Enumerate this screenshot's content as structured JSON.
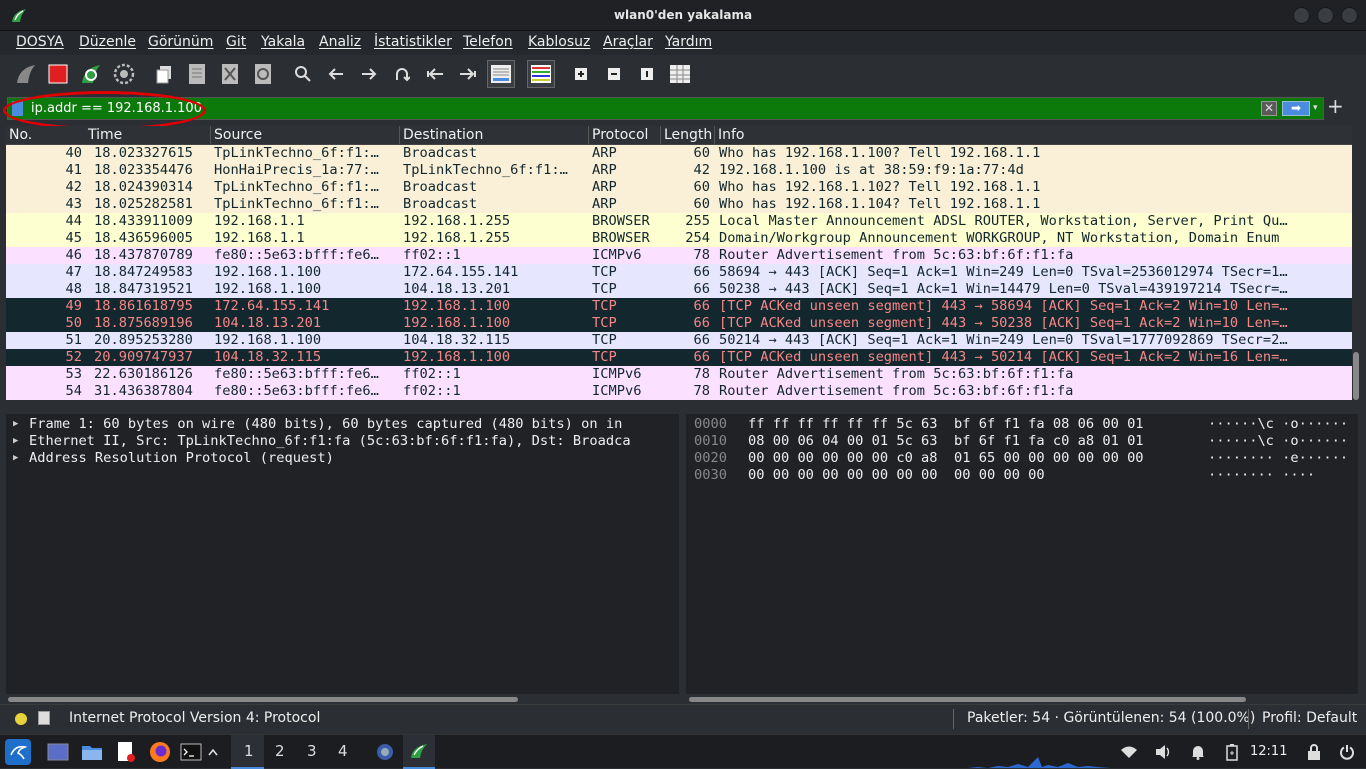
{
  "window": {
    "title": "wlan0'den yakalama"
  },
  "menu": [
    "DOSYA",
    "Düzenle",
    "Görünüm",
    "Git",
    "Yakala",
    "Analiz",
    "İstatistikler",
    "Telefon",
    "Kablosuz",
    "Araçlar",
    "Yardım"
  ],
  "toolbar": {
    "icons": [
      "shark-fin-start-icon",
      "stop-capture-icon",
      "restart-capture-icon",
      "capture-options-icon",
      "open-file-icon",
      "save-file-icon",
      "close-file-icon",
      "reload-file-icon",
      "find-packet-icon",
      "go-back-icon",
      "go-forward-icon",
      "go-to-packet-icon",
      "first-packet-icon",
      "last-packet-icon",
      "autoscroll-icon",
      "colorize-icon",
      "zoom-in-icon",
      "zoom-out-icon",
      "normal-size-icon",
      "resize-columns-icon"
    ]
  },
  "filter": {
    "value": "ip.addr == 192.168.1.100",
    "clear": "✕",
    "apply": "➡",
    "add": "+"
  },
  "columns": [
    "No.",
    "Time",
    "Source",
    "Destination",
    "Protocol",
    "Length",
    "Info"
  ],
  "packets": [
    {
      "no": "40",
      "time": "18.023327615",
      "src": "TpLinkTechno_6f:f1:…",
      "dst": "Broadcast",
      "proto": "ARP",
      "len": "60",
      "info": "Who has 192.168.1.100? Tell 192.168.1.1",
      "bg": "#faf0d7",
      "fg": "#12272e"
    },
    {
      "no": "41",
      "time": "18.023354476",
      "src": "HonHaiPrecis_1a:77:…",
      "dst": "TpLinkTechno_6f:f1:…",
      "proto": "ARP",
      "len": "42",
      "info": "192.168.1.100 is at 38:59:f9:1a:77:4d",
      "bg": "#faf0d7",
      "fg": "#12272e"
    },
    {
      "no": "42",
      "time": "18.024390314",
      "src": "TpLinkTechno_6f:f1:…",
      "dst": "Broadcast",
      "proto": "ARP",
      "len": "60",
      "info": "Who has 192.168.1.102? Tell 192.168.1.1",
      "bg": "#faf0d7",
      "fg": "#12272e"
    },
    {
      "no": "43",
      "time": "18.025282581",
      "src": "TpLinkTechno_6f:f1:…",
      "dst": "Broadcast",
      "proto": "ARP",
      "len": "60",
      "info": "Who has 192.168.1.104? Tell 192.168.1.1",
      "bg": "#faf0d7",
      "fg": "#12272e"
    },
    {
      "no": "44",
      "time": "18.433911009",
      "src": "192.168.1.1",
      "dst": "192.168.1.255",
      "proto": "BROWSER",
      "len": "255",
      "info": "Local Master Announcement ADSL ROUTER, Workstation, Server, Print Qu…",
      "bg": "#feffd0",
      "fg": "#12272e"
    },
    {
      "no": "45",
      "time": "18.436596005",
      "src": "192.168.1.1",
      "dst": "192.168.1.255",
      "proto": "BROWSER",
      "len": "254",
      "info": "Domain/Workgroup Announcement WORKGROUP, NT Workstation, Domain Enum",
      "bg": "#feffd0",
      "fg": "#12272e"
    },
    {
      "no": "46",
      "time": "18.437870789",
      "src": "fe80::5e63:bfff:fe6…",
      "dst": "ff02::1",
      "proto": "ICMPv6",
      "len": "78",
      "info": "Router Advertisement from 5c:63:bf:6f:f1:fa",
      "bg": "#fce0ff",
      "fg": "#12272e"
    },
    {
      "no": "47",
      "time": "18.847249583",
      "src": "192.168.1.100",
      "dst": "172.64.155.141",
      "proto": "TCP",
      "len": "66",
      "info": "58694 → 443 [ACK] Seq=1 Ack=1 Win=249 Len=0 TSval=2536012974 TSecr=1…",
      "bg": "#e7e6ff",
      "fg": "#12272e"
    },
    {
      "no": "48",
      "time": "18.847319521",
      "src": "192.168.1.100",
      "dst": "104.18.13.201",
      "proto": "TCP",
      "len": "66",
      "info": "50238 → 443 [ACK] Seq=1 Ack=1 Win=14479 Len=0 TSval=439197214 TSecr=…",
      "bg": "#e7e6ff",
      "fg": "#12272e"
    },
    {
      "no": "49",
      "time": "18.861618795",
      "src": "172.64.155.141",
      "dst": "192.168.1.100",
      "proto": "TCP",
      "len": "66",
      "info": "[TCP ACKed unseen segment] 443 → 58694 [ACK] Seq=1 Ack=2 Win=10 Len=…",
      "bg": "#12272e",
      "fg": "#f78787"
    },
    {
      "no": "50",
      "time": "18.875689196",
      "src": "104.18.13.201",
      "dst": "192.168.1.100",
      "proto": "TCP",
      "len": "66",
      "info": "[TCP ACKed unseen segment] 443 → 50238 [ACK] Seq=1 Ack=2 Win=10 Len=…",
      "bg": "#12272e",
      "fg": "#f78787"
    },
    {
      "no": "51",
      "time": "20.895253280",
      "src": "192.168.1.100",
      "dst": "104.18.32.115",
      "proto": "TCP",
      "len": "66",
      "info": "50214 → 443 [ACK] Seq=1 Ack=1 Win=249 Len=0 TSval=1777092869 TSecr=2…",
      "bg": "#e7e6ff",
      "fg": "#12272e"
    },
    {
      "no": "52",
      "time": "20.909747937",
      "src": "104.18.32.115",
      "dst": "192.168.1.100",
      "proto": "TCP",
      "len": "66",
      "info": "[TCP ACKed unseen segment] 443 → 50214 [ACK] Seq=1 Ack=2 Win=16 Len=…",
      "bg": "#12272e",
      "fg": "#f78787"
    },
    {
      "no": "53",
      "time": "22.630186126",
      "src": "fe80::5e63:bfff:fe6…",
      "dst": "ff02::1",
      "proto": "ICMPv6",
      "len": "78",
      "info": "Router Advertisement from 5c:63:bf:6f:f1:fa",
      "bg": "#fce0ff",
      "fg": "#12272e"
    },
    {
      "no": "54",
      "time": "31.436387804",
      "src": "fe80::5e63:bfff:fe6…",
      "dst": "ff02::1",
      "proto": "ICMPv6",
      "len": "78",
      "info": "Router Advertisement from 5c:63:bf:6f:f1:fa",
      "bg": "#fce0ff",
      "fg": "#12272e"
    }
  ],
  "details": [
    "Frame 1: 60 bytes on wire (480 bits), 60 bytes captured (480 bits) on in",
    "Ethernet II, Src: TpLinkTechno_6f:f1:fa (5c:63:bf:6f:f1:fa), Dst: Broadca",
    "Address Resolution Protocol (request)"
  ],
  "bytes": [
    {
      "offset": "0000",
      "hex": "ff ff ff ff ff ff 5c 63  bf 6f f1 fa 08 06 00 01",
      "ascii": "······\\c ·o······"
    },
    {
      "offset": "0010",
      "hex": "08 00 06 04 00 01 5c 63  bf 6f f1 fa c0 a8 01 01",
      "ascii": "······\\c ·o······"
    },
    {
      "offset": "0020",
      "hex": "00 00 00 00 00 00 c0 a8  01 65 00 00 00 00 00 00",
      "ascii": "········ ·e······"
    },
    {
      "offset": "0030",
      "hex": "00 00 00 00 00 00 00 00  00 00 00 00",
      "ascii": "········ ····"
    }
  ],
  "status": {
    "field": "Internet Protocol Version 4: Protocol",
    "packets": "Paketler: 54 · Görüntülenen: 54 (100.0%)",
    "profile": "Profil: Default"
  },
  "taskbar": {
    "workspaces": [
      "1",
      "2",
      "3",
      "4"
    ],
    "clock": "12:11"
  },
  "colors": {
    "filter_valid": "#0b7a0b",
    "highlight_ring": "#e00000",
    "accent": "#4a8de0"
  }
}
